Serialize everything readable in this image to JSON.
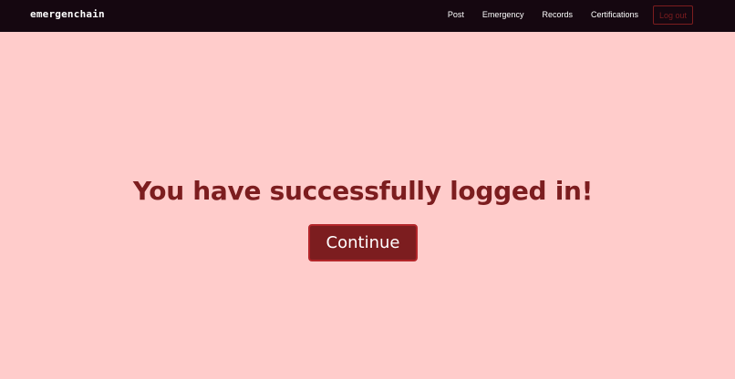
{
  "navbar": {
    "brand": "emergenchain",
    "links": [
      {
        "label": "Post"
      },
      {
        "label": "Emergency"
      },
      {
        "label": "Records"
      },
      {
        "label": "Certifications"
      }
    ],
    "logout_label": "Log out"
  },
  "main": {
    "headline": "You have successfully logged in!",
    "continue_label": "Continue"
  },
  "colors": {
    "page_background": "#ffcccb",
    "navbar_background": "#150710",
    "accent": "#7c1d1f",
    "button_border": "#b3262a"
  }
}
